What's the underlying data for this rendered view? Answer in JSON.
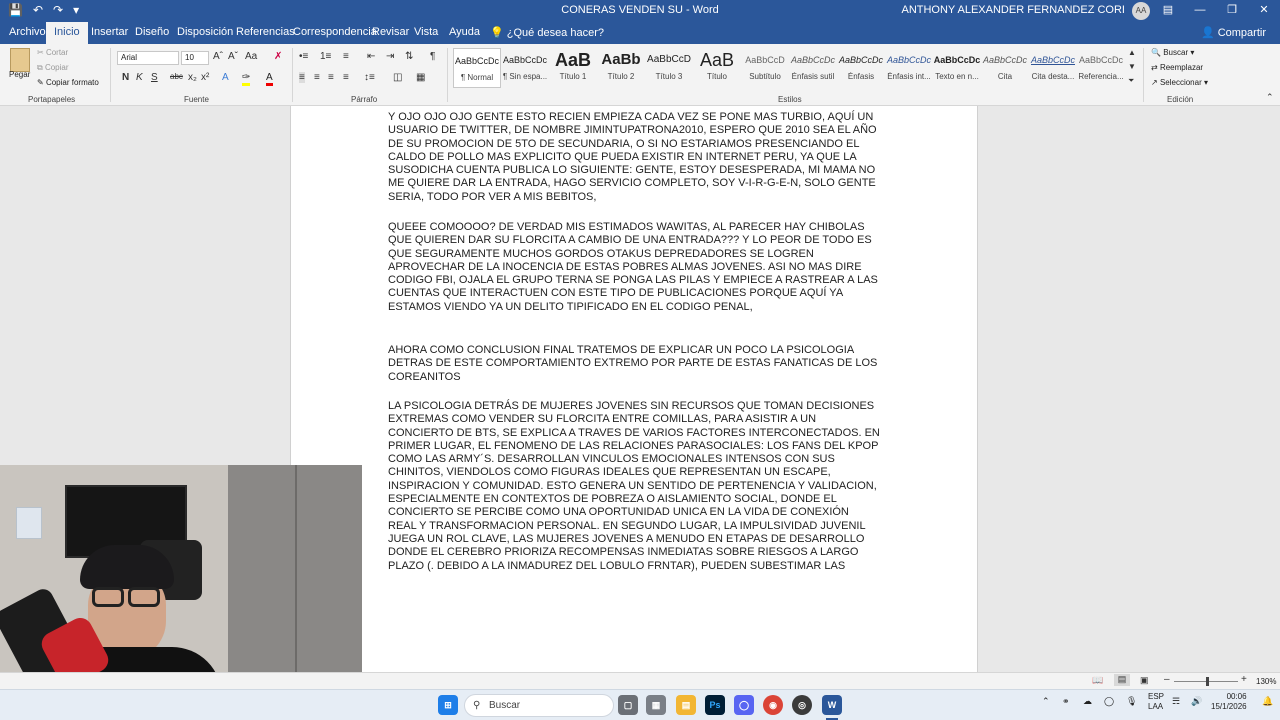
{
  "titlebar": {
    "document_title": "CONERAS VENDEN SU  -  Word",
    "user_name": "ANTHONY ALEXANDER FERNANDEZ CORI",
    "avatar_initials": "AA"
  },
  "tabs": {
    "items": [
      "Archivo",
      "Inicio",
      "Insertar",
      "Diseño",
      "Disposición",
      "Referencias",
      "Correspondencia",
      "Revisar",
      "Vista",
      "Ayuda"
    ],
    "tell_me": "¿Qué desea hacer?",
    "share": "Compartir"
  },
  "ribbon": {
    "clipboard": {
      "paste": "Pegar",
      "cut": "Cortar",
      "copy": "Copiar",
      "format_painter": "Copiar formato",
      "label": "Portapapeles"
    },
    "font": {
      "name": "Arial",
      "size": "10",
      "label": "Fuente"
    },
    "paragraph": {
      "label": "Párrafo"
    },
    "styles": {
      "label": "Estilos",
      "items": [
        {
          "preview": "AaBbCcDc",
          "name": "¶ Normal"
        },
        {
          "preview": "AaBbCcDc",
          "name": "¶ Sin espa..."
        },
        {
          "preview": "AaB",
          "name": "Título 1"
        },
        {
          "preview": "AaBb",
          "name": "Título 2"
        },
        {
          "preview": "AaBbCcD",
          "name": "Título 3"
        },
        {
          "preview": "AaB",
          "name": "Título"
        },
        {
          "preview": "AaBbCcD",
          "name": "Subtítulo"
        },
        {
          "preview": "AaBbCcDc",
          "name": "Énfasis sutil"
        },
        {
          "preview": "AaBbCcDc",
          "name": "Énfasis"
        },
        {
          "preview": "AaBbCcDc",
          "name": "Énfasis int..."
        },
        {
          "preview": "AaBbCcDc",
          "name": "Texto en n..."
        },
        {
          "preview": "AaBbCcDc",
          "name": "Cita"
        },
        {
          "preview": "AaBbCcDc",
          "name": "Cita desta..."
        },
        {
          "preview": "AaBbCcDc",
          "name": "Referencia..."
        }
      ]
    },
    "editing": {
      "find": "Buscar",
      "replace": "Reemplazar",
      "select": "Seleccionar",
      "label": "Edición"
    }
  },
  "document": {
    "paragraphs": [
      "Y OJO OJO OJO GENTE ESTO RECIEN EMPIEZA CADA VEZ SE PONE MAS TURBIO, AQUÍ UN USUARIO DE TWITTER, DE NOMBRE JIMINTUPATRONA2010, ESPERO QUE 2010 SEA EL AÑO DE SU PROMOCION DE 5TO DE SECUNDARIA, O SI NO ESTARIAMOS PRESENCIANDO EL CALDO DE POLLO MAS EXPLICITO QUE PUEDA EXISTIR EN INTERNET PERU, YA QUE LA SUSODICHA CUENTA PUBLICA LO SIGUIENTE: GENTE, ESTOY DESESPERADA,  MI MAMA NO ME QUIERE DAR LA ENTRADA, HAGO SERVICIO COMPLETO, SOY V-I-R-G-E-N, SOLO GENTE SERIA, TODO POR VER A MIS BEBITOS,",
      "QUEEE COMOOOO? DE VERDAD MIS ESTIMADOS WAWITAS, AL PARECER HAY CHIBOLAS QUE QUIEREN DAR SU FLORCITA A CAMBIO DE UNA ENTRADA??? Y LO PEOR DE TODO ES QUE SEGURAMENTE MUCHOS GORDOS OTAKUS DEPREDADORES SE LOGREN APROVECHAR DE LA INOCENCIA DE ESTAS POBRES ALMAS JOVENES. ASI NO MAS DIRE CODIGO FBI, OJALA EL GRUPO TERNA SE PONGA LAS PILAS Y EMPIECE A RASTREAR A LAS CUENTAS QUE INTERACTUEN CON ESTE TIPO DE PUBLICACIONES PORQUE AQUÍ YA ESTAMOS VIENDO YA UN DELITO TIPIFICADO EN EL CODIGO PENAL,",
      "AHORA COMO CONCLUSION FINAL TRATEMOS DE EXPLICAR UN POCO LA PSICOLOGIA DETRAS DE ESTE COMPORTAMIENTO EXTREMO POR PARTE DE ESTAS FANATICAS DE LOS COREANITOS",
      "LA PSICOLOGIA DETRÁS DE MUJERES JOVENES SIN RECURSOS QUE TOMAN DECISIONES EXTREMAS COMO VENDER SU FLORCITA ENTRE COMILLAS, PARA ASISTIR A UN CONCIERTO DE BTS, SE EXPLICA A TRAVES DE VARIOS FACTORES INTERCONECTADOS. EN PRIMER LUGAR, EL FENOMENO DE LAS RELACIONES PARASOCIALES: LOS FANS DEL KPOP COMO LAS ARMY´S. DESARROLLAN VINCULOS EMOCIONALES INTENSOS CON SUS CHINITOS, VIENDOLOS COMO FIGURAS IDEALES QUE REPRESENTAN UN ESCAPE, INSPIRACION Y COMUNIDAD. ESTO GENERA UN SENTIDO DE PERTENENCIA Y VALIDACION, ESPECIALMENTE EN CONTEXTOS DE POBREZA O AISLAMIENTO SOCIAL, DONDE EL CONCIERTO SE PERCIBE COMO UNA OPORTUNIDAD UNICA EN LA VIDA DE CONEXIÓN REAL Y TRANSFORMACION PERSONAL. EN SEGUNDO LUGAR, LA IMPULSIVIDAD JUVENIL JUEGA UN ROL CLAVE, LAS MUJERES JOVENES A MENUDO EN ETAPAS DE DESARROLLO DONDE EL CEREBRO PRIORIZA RECOMPENSAS INMEDIATAS SOBRE RIESGOS A LARGO PLAZO (. DEBIDO A LA INMADUREZ DEL LOBULO FRNTAR), PUEDEN SUBESTIMAR LAS"
    ]
  },
  "statusbar": {
    "zoom": "130%"
  },
  "taskbar": {
    "search_label": "Buscar",
    "language": "ESP",
    "layout": "LAA",
    "time": "00:06",
    "date": "15/1/2026"
  }
}
